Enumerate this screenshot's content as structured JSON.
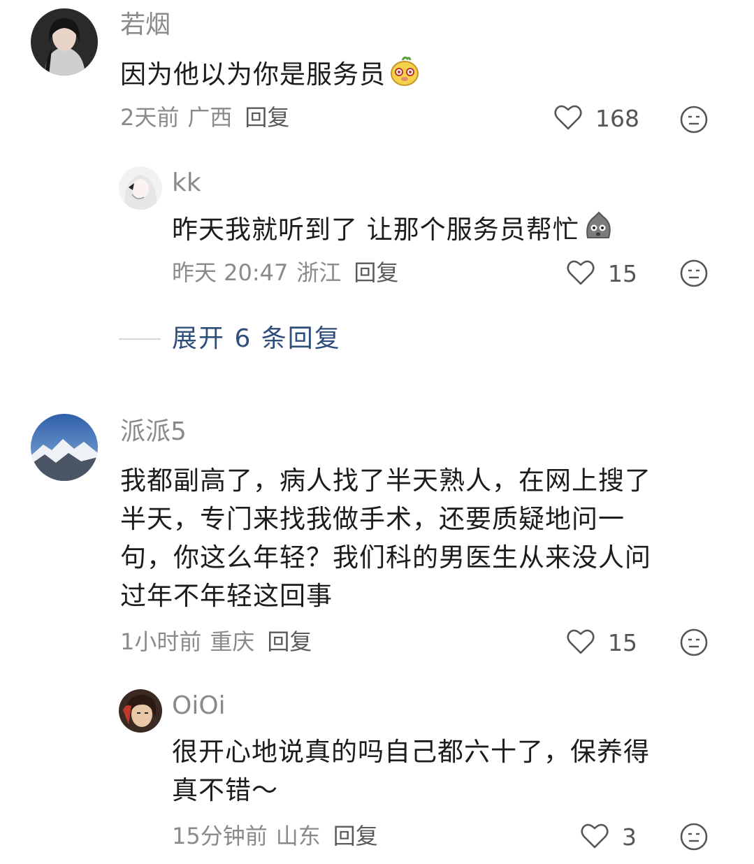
{
  "comments": [
    {
      "name": "若烟",
      "text": "因为他以为你是服务员",
      "emoji": "potato-face-emoji",
      "time": "2天前",
      "location": "广西",
      "reply": "回复",
      "likes": "168"
    },
    {
      "name": "kk",
      "text": "昨天我就听到了 让那个服务员帮忙",
      "emoji": "gray-bag-face-emoji",
      "time": "昨天 20:47",
      "location": "浙江",
      "reply": "回复",
      "likes": "15"
    },
    {
      "name": "派派5",
      "text_lines": [
        "我都副高了，病人找了半天熟人，在网上搜了",
        "半天，专门来找我做手术，还要质疑地问一",
        "句，你这么年轻？我们科的男医生从来没人问",
        "过年不年轻这回事"
      ],
      "time": "1小时前",
      "location": "重庆",
      "reply": "回复",
      "likes": "15"
    },
    {
      "name": "OiOi",
      "text_lines": [
        "很开心地说真的吗自己都六十了，保养得",
        "真不错～"
      ],
      "time": "15分钟前",
      "location": "山东",
      "reply": "回复",
      "likes": "3"
    }
  ],
  "expand_replies": "展开 6 条回复",
  "colors": {
    "link": "#2f4e7a",
    "meta": "#8a8a8a",
    "text": "#1c1c1c"
  },
  "icons": {
    "like": "heart-outline-icon",
    "dislike": "neutral-face-icon"
  }
}
